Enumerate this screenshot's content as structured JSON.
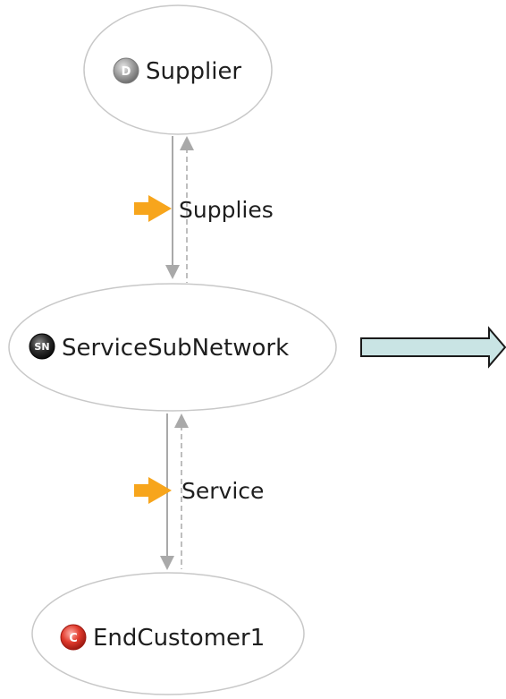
{
  "nodes": {
    "supplier": {
      "label": "Supplier",
      "badge": "D",
      "badge_color": "#9a9a9a"
    },
    "subnetwork": {
      "label": "ServiceSubNetwork",
      "badge": "SN",
      "badge_color": "#2a2a2a"
    },
    "customer": {
      "label": "EndCustomer1",
      "badge": "C",
      "badge_color": "#d93a2e"
    }
  },
  "edges": {
    "supplies": {
      "label": "Supplies",
      "icon": "orange-arrow-icon"
    },
    "service": {
      "label": "Service",
      "icon": "orange-arrow-icon"
    }
  },
  "colors": {
    "node_border": "#c8c8c8",
    "edge_line": "#a9a9a9",
    "flow_arrow": "#f7a51c",
    "block_arrow_fill": "#c9e4e4",
    "block_arrow_stroke": "#1a1a1a"
  },
  "icons": {
    "block_arrow": "block-right-arrow-icon"
  }
}
